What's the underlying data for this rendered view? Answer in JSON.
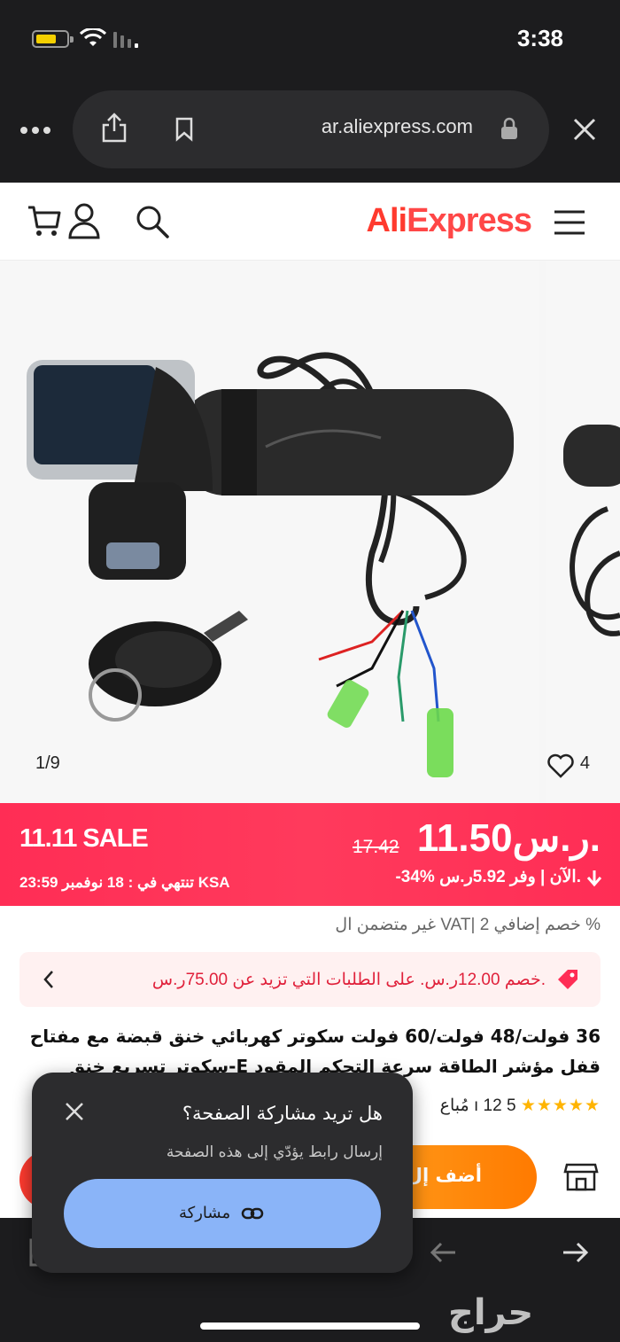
{
  "status_bar": {
    "time": "3:38"
  },
  "browser": {
    "url": "ar.aliexpress.com"
  },
  "site_header": {
    "logo_part1": "Ali",
    "logo_part2": "Express"
  },
  "gallery": {
    "counter": "1/9",
    "likes": "4"
  },
  "price_banner": {
    "price": "11.50ر.س.",
    "old_price": "17.42",
    "discount_line": "-34% الآن | وفر 5.92ر.س.",
    "sale_label": "11.11 SALE",
    "ends_label": "تنتهي في :  18 نوفمبر 23:59 KSA"
  },
  "vat_line": "غير متضمن ال VAT| خصم إضافي 2 %",
  "coupon": {
    "text": "خصم 12.00ر.س. على الطلبات التي تزيد عن 75.00ر.س."
  },
  "product": {
    "title": "36 فولت/48 فولت/60 فولت سكوتر كهربائي خنق قبضة مع مفتاح قفل مؤشر الطاقة سرعة التحكم المقود E-سكوتر تسريع خنق",
    "rating_value": "5",
    "sold_text": "12 مُباع",
    "rating_sep": "ı"
  },
  "actions": {
    "add_to_cart": "أضف إل"
  },
  "share_sheet": {
    "title": "هل تريد مشاركة الصفحة؟",
    "subtitle": "إرسال رابط يؤدّي إلى هذه الصفحة",
    "share_button": "مشاركة"
  },
  "watermark": "حراج",
  "colors": {
    "sale_banner": "#ff2d55",
    "cart_button": "#ff8a00",
    "share_button": "#8ab4f8",
    "coupon_text": "#e0203a"
  }
}
